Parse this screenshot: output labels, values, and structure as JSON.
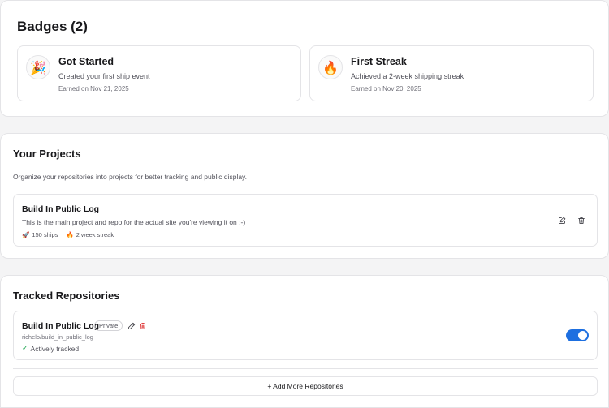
{
  "badges": {
    "title": "Badges (2)",
    "items": [
      {
        "emoji": "🎉",
        "icon": "party-popper-icon",
        "name": "Got Started",
        "description": "Created your first ship event",
        "earned": "Earned on Nov 21, 2025"
      },
      {
        "emoji": "🔥",
        "icon": "fire-icon",
        "name": "First Streak",
        "description": "Achieved a 2-week shipping streak",
        "earned": "Earned on Nov 20, 2025"
      }
    ]
  },
  "projects": {
    "title": "Your Projects",
    "description": "Organize your repositories into projects for better tracking and public display.",
    "items": [
      {
        "name": "Build In Public Log",
        "description": "This is the main project and repo for the actual site you're viewing it on ;-)",
        "ships_emoji": "🚀",
        "ships": "150 ships",
        "streak_emoji": "🔥",
        "streak": "2 week streak",
        "edit_icon": "edit-icon",
        "delete_icon": "trash-icon"
      }
    ]
  },
  "repos": {
    "title": "Tracked Repositories",
    "items": [
      {
        "name": "Build In Public Log",
        "visibility": "Private",
        "path": "richelo/build_in_public_log",
        "status_icon": "✓",
        "status": "Actively tracked",
        "tracked": true
      }
    ],
    "add_button": "+ Add More Repositories"
  },
  "colors": {
    "accent": "#1d6fe0",
    "danger": "#dc2626",
    "success": "#16a34a"
  }
}
